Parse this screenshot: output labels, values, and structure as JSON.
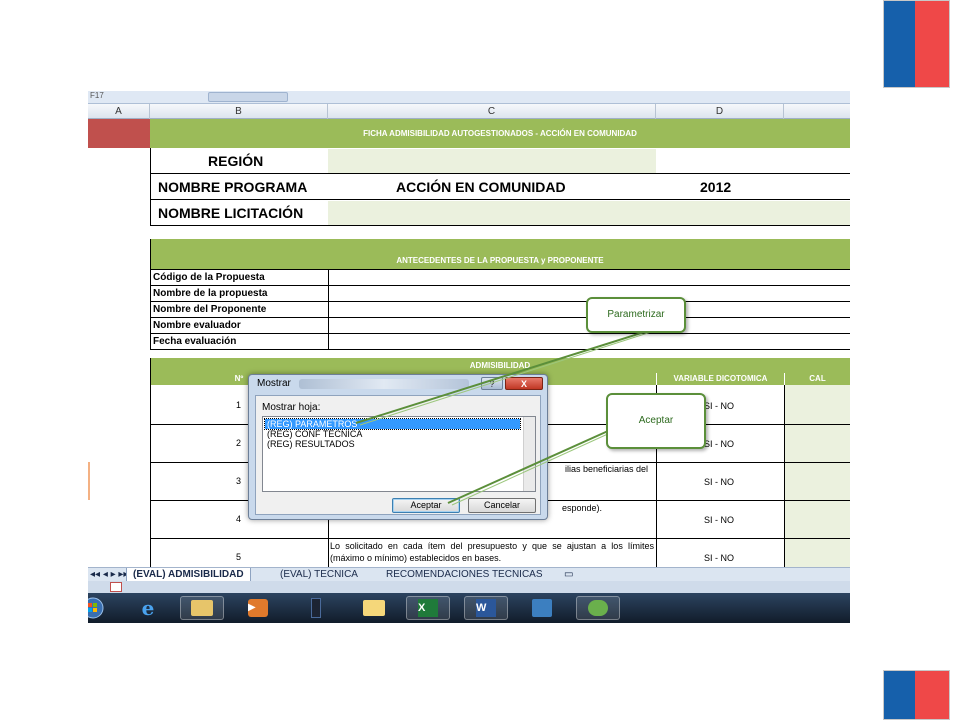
{
  "sheet": {
    "formula_cell": "F17",
    "columns": [
      "A",
      "B",
      "C",
      "D"
    ],
    "main_title": "FICHA ADMISIBILIDAD AUTOGESTIONADOS - ACCIÓN EN COMUNIDAD",
    "region_label": "REGIÓN",
    "programa_label": "NOMBRE PROGRAMA",
    "programa_value": "ACCIÓN EN COMUNIDAD",
    "year_value": "2012",
    "licitacion_label": "NOMBRE LICITACIÓN",
    "antecedentes_title": "ANTECEDENTES DE LA PROPUESTA y PROPONENTE",
    "antecedentes_rows": [
      "Código de la Propuesta",
      "Nombre de la propuesta",
      "Nombre del Proponente",
      "Nombre evaluador",
      "Fecha evaluación"
    ],
    "admisibilidad_title": "ADMISIBILIDAD",
    "header_num": "Nº",
    "header_variable": "VARIABLE DICOTOMICA",
    "header_cal": "CAL",
    "rows": [
      {
        "num": "1",
        "text": "",
        "value": "SI - NO"
      },
      {
        "num": "2",
        "text": "",
        "value": "SI - NO"
      },
      {
        "num": "3",
        "text": "ilias beneficiarias del",
        "value": "SI - NO"
      },
      {
        "num": "4",
        "text": "esponde).",
        "value": "SI - NO"
      },
      {
        "num": "5",
        "text": "Lo solicitado en cada ítem del presupuesto y que se ajustan a los límites (máximo o mínimo) establecidos en bases.",
        "value": "SI - NO"
      }
    ]
  },
  "tabs": [
    "(EVAL) ADMISIBILIDAD",
    "(EVAL) TECNICA",
    "RECOMENDACIONES TECNICAS"
  ],
  "dialog": {
    "title": "Mostrar",
    "help_label": "?",
    "close_label": "X",
    "list_label": "Mostrar hoja:",
    "items": [
      "(REG) PARAMETROS",
      "(REG) CONF TECNICA",
      "(REG) RESULTADOS"
    ],
    "accept_label": "Aceptar",
    "cancel_label": "Cancelar"
  },
  "callouts": {
    "parametrizar": "Parametrizar",
    "aceptar": "Aceptar"
  },
  "colors": {
    "header_green": "#9bbb59",
    "light_green": "#ebf1de",
    "callout_green": "#5b8f3a",
    "flag_blue": "#1660ab",
    "flag_red": "#ef4848"
  }
}
